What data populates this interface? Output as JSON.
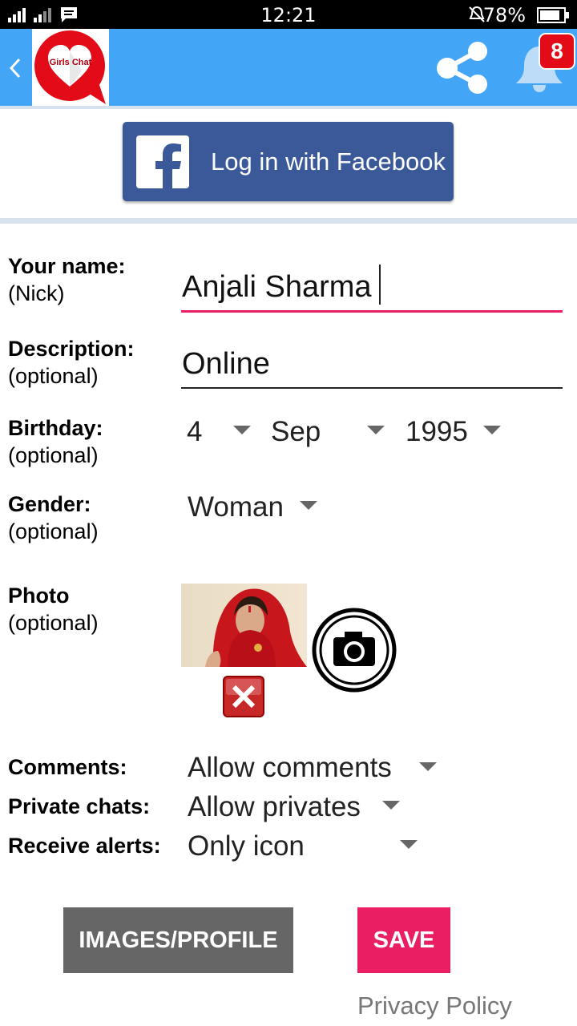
{
  "status_bar": {
    "time": "12:21",
    "battery": "78%"
  },
  "app_bar": {
    "logo_text": "Girls Chat",
    "notification_count": "8"
  },
  "facebook": {
    "label": "Log in with Facebook"
  },
  "form": {
    "name_label": "Your name:",
    "name_sub": "(Nick)",
    "name_value": "Anjali Sharma",
    "desc_label": "Description:",
    "desc_sub": "(optional)",
    "desc_value": "Online",
    "birthday_label": "Birthday:",
    "birthday_sub": "(optional)",
    "birthday_day": "4",
    "birthday_month": "Sep",
    "birthday_year": "1995",
    "gender_label": "Gender:",
    "gender_sub": "(optional)",
    "gender_value": "Woman",
    "photo_label": "Photo",
    "photo_sub": "(optional)",
    "comments_label": "Comments:",
    "comments_value": "Allow comments",
    "privates_label": "Private chats:",
    "privates_value": "Allow privates",
    "alerts_label": "Receive alerts:",
    "alerts_value": "Only icon"
  },
  "actions": {
    "images_profile": "IMAGES/PROFILE",
    "save": "SAVE",
    "privacy": "Privacy Policy"
  },
  "colors": {
    "app_bar": "#42a5f5",
    "facebook": "#3b5998",
    "accent": "#e91e63",
    "images_button": "#666666"
  }
}
